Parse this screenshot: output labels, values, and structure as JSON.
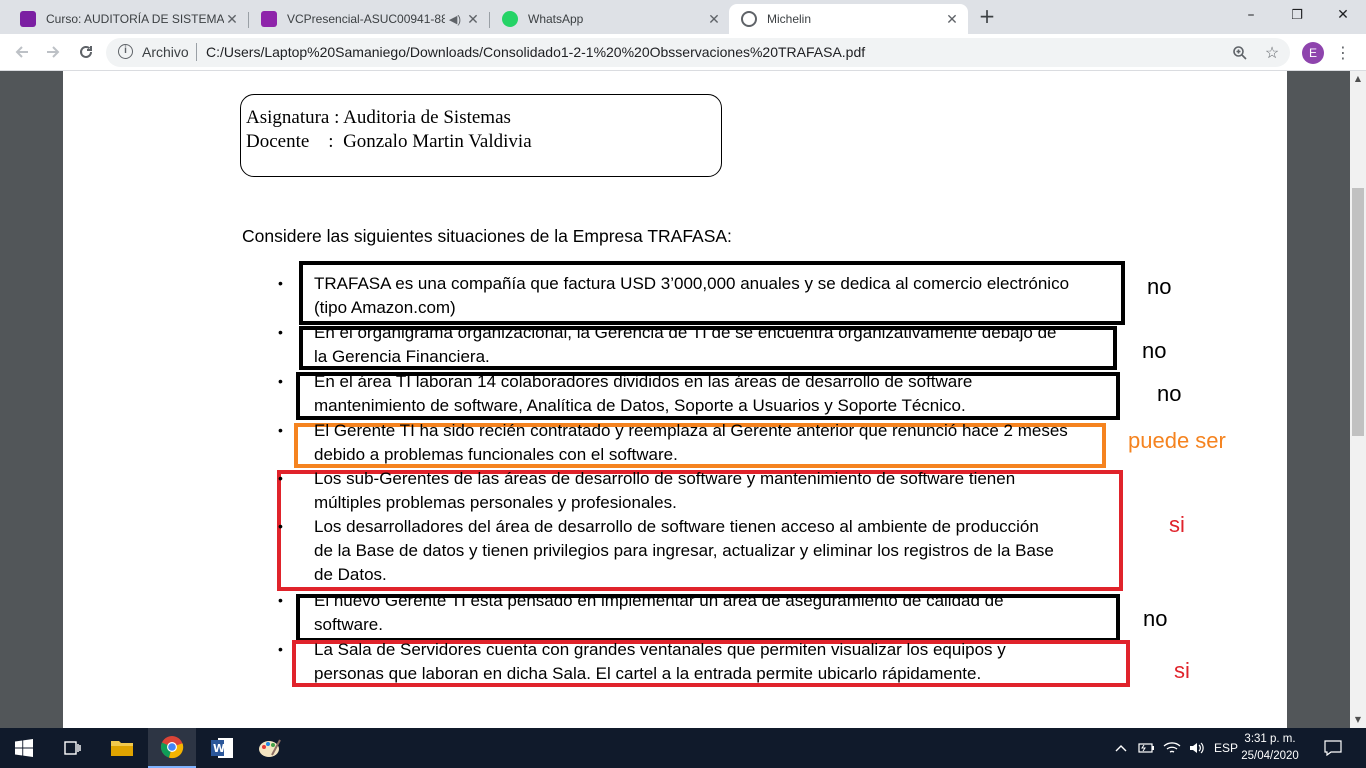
{
  "browser": {
    "tabs": [
      {
        "title": "Curso: AUDITORÍA DE SISTEMAS",
        "favicon": "moodle-icon",
        "color": "#7b1fa2"
      },
      {
        "title": "VCPresencial-ASUC00941-88",
        "favicon": "video-icon",
        "color": "#8e24aa",
        "audio": true
      },
      {
        "title": "WhatsApp",
        "favicon": "whatsapp-icon",
        "color": "#25d366"
      },
      {
        "title": "Michelin",
        "favicon": "globe-icon",
        "color": "#5f6368",
        "active": true
      }
    ],
    "new_tab_label": "+",
    "window_controls": {
      "minimize": "–",
      "maximize": "❐",
      "close": "✕"
    },
    "address": {
      "scheme_label": "Archivo",
      "url": "C:/Users/Laptop%20Samaniego/Downloads/Consolidado1-2-1%20%20Obsservaciones%20TRAFASA.pdf"
    },
    "profile_initial": "E"
  },
  "document": {
    "header": {
      "line1": "Asignatura : Auditoria de Sistemas",
      "line2": "Docente    :  Gonzalo Martin Valdivia"
    },
    "intro": "Considere las siguientes situaciones de la Empresa TRAFASA:",
    "items": [
      {
        "l1": "TRAFASA es una compañía que factura USD 3’000,000 anuales y se dedica al comercio electrónico",
        "l2": "(tipo Amazon.com)"
      },
      {
        "l1": "En el organigrama organizacional,  la Gerencia de TI de se encuentra organizativamente debajo de",
        "l2": "la Gerencia Financiera."
      },
      {
        "l1": "En el área TI laboran 14 colaboradores divididos en las áreas de desarrollo de software",
        "l2": "mantenimiento de software,  Analítica de Datos, Soporte a Usuarios y Soporte Técnico."
      },
      {
        "l1": "El Gerente TI ha sido recién contratado y reemplaza al Gerente anterior que renunció hace 2 meses",
        "l2": "debido a problemas funcionales con el software."
      },
      {
        "l1": "Los sub-Gerentes de las áreas de desarrollo de software y mantenimiento de software tienen",
        "l2": "múltiples problemas personales y profesionales."
      },
      {
        "l1": "Los desarrolladores del área de desarrollo de software tienen acceso al ambiente de producción",
        "l2": "de la Base de datos y  tienen privilegios para ingresar, actualizar y eliminar  los registros de la Base",
        "l3": "de Datos."
      },
      {
        "l1": "El nuevo Gerente TI está pensado en implementar un área de aseguramiento de calidad de",
        "l2": "software."
      },
      {
        "l1": "La Sala de Servidores cuenta con grandes ventanales que permiten visualizar los equipos y",
        "l2": "personas que laboran en dicha Sala. El cartel a la entrada permite ubicarlo rápidamente."
      }
    ],
    "verdicts": [
      {
        "label": "no",
        "color": "#000000"
      },
      {
        "label": "no",
        "color": "#000000"
      },
      {
        "label": "no",
        "color": "#000000"
      },
      {
        "label": "puede ser",
        "color": "#f5831f"
      },
      {
        "label": "si",
        "color": "#e0232b"
      },
      {
        "label": "no",
        "color": "#000000"
      },
      {
        "label": "si",
        "color": "#e0232b"
      }
    ],
    "bullet_glyph": "•"
  },
  "taskbar": {
    "language": "ESP",
    "time": "3:31 p. m.",
    "date": "25/04/2020"
  }
}
